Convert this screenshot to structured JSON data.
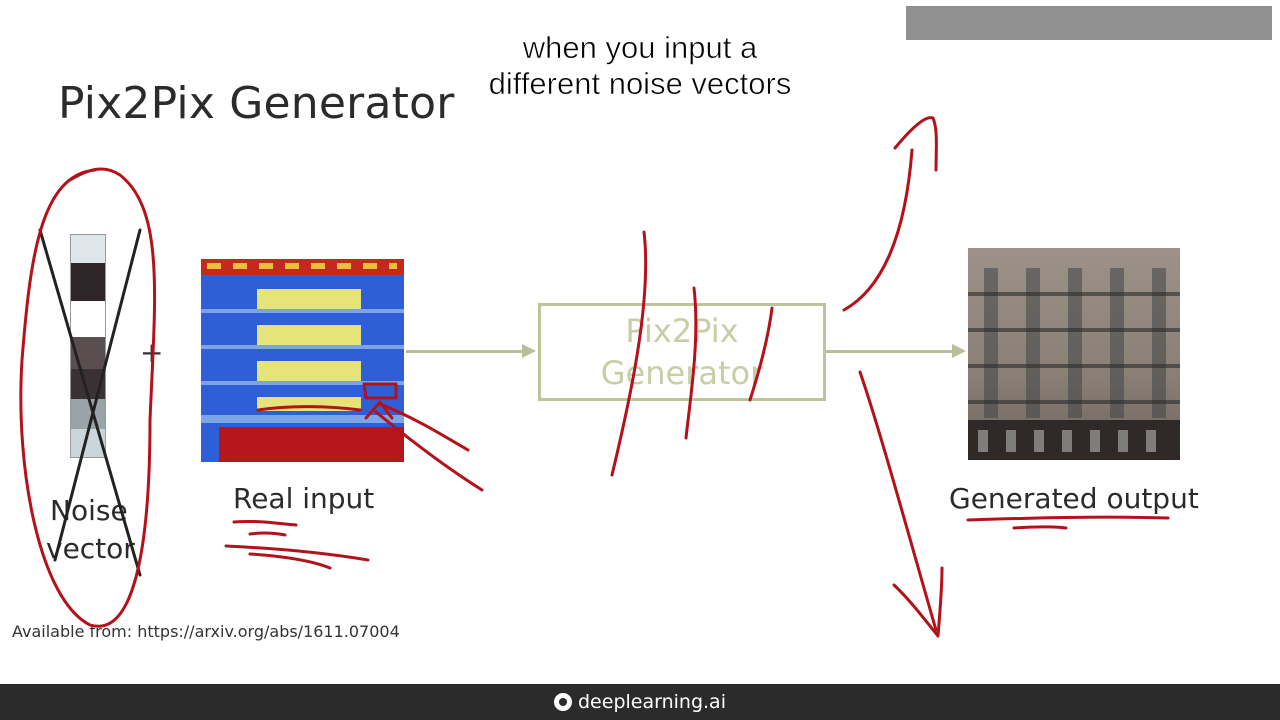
{
  "slide": {
    "title": "Pix2Pix Generator",
    "caption_line1": "when you input a",
    "caption_line2": "different noise vectors",
    "noise_label_line1": "Noise",
    "noise_label_line2": "vector",
    "plus_symbol": "+",
    "real_input_label": "Real input",
    "generator_line1": "Pix2Pix",
    "generator_line2": "Generator",
    "output_label": "Generated output",
    "source": "Available from: https://arxiv.org/abs/1611.07004"
  },
  "footer": {
    "brand": "deeplearning.ai",
    "logo_icon": "deeplearning-logo-icon"
  },
  "colors": {
    "annotation": "#b3121b",
    "arrow": "#b9bd99",
    "footer_bg": "#2b2b2b"
  }
}
